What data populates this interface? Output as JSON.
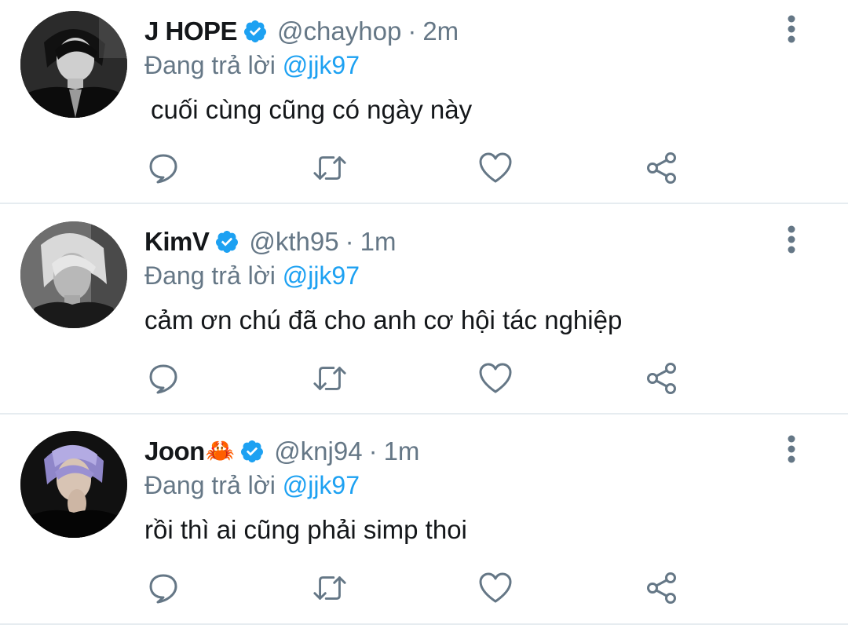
{
  "tweets": [
    {
      "name": "J HOPE",
      "name_emoji": "",
      "handle": "@chayhop",
      "separator": "·",
      "time": "2m",
      "reply_prefix": "Đang trả lời",
      "reply_to": "@jjk97",
      "text": "cuối cùng cũng có ngày này",
      "avatar_icon": "bw-portrait"
    },
    {
      "name": "KimV",
      "name_emoji": "",
      "handle": "@kth95",
      "separator": "·",
      "time": "1m",
      "reply_prefix": "Đang trả lời",
      "reply_to": "@jjk97",
      "text": "cảm ơn chú đã cho anh cơ hội tác nghiệp",
      "avatar_icon": "gray-portrait"
    },
    {
      "name": "Joon",
      "name_emoji": "🦀",
      "handle": "@knj94",
      "separator": "·",
      "time": "1m",
      "reply_prefix": "Đang trả lời",
      "reply_to": "@jjk97",
      "text": "rồi thì ai cũng phải simp thoi",
      "avatar_icon": "purple-hair-portrait"
    }
  ],
  "icons": {
    "verified": "verified-badge-icon",
    "more": "more-vertical-icon",
    "reply": "reply-icon",
    "retweet": "retweet-icon",
    "like": "heart-icon",
    "share": "share-icon"
  },
  "colors": {
    "accent": "#1da1f2",
    "text": "#14171a",
    "secondary": "#657786",
    "divider": "#e6ecf0"
  }
}
